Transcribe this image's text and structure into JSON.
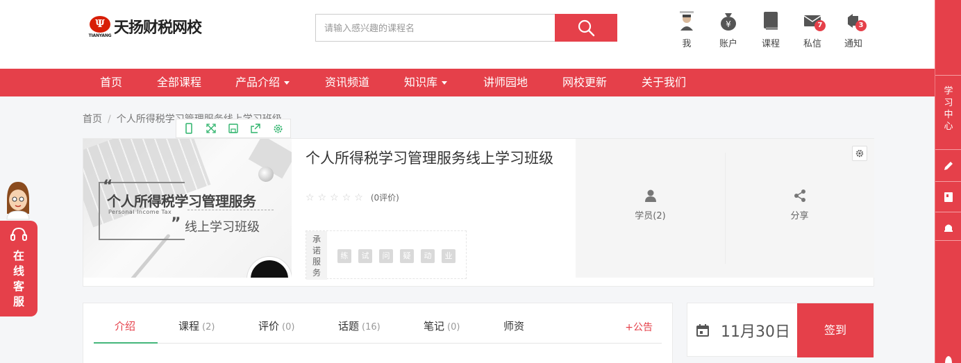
{
  "header": {
    "logo_text": "天扬财税网校",
    "logo_sub": "TIANYANG",
    "search_placeholder": "请输入感兴趣的课程名",
    "icons": [
      {
        "label": "我",
        "icon": "user-avatar-icon"
      },
      {
        "label": "账户",
        "icon": "money-bag-icon"
      },
      {
        "label": "课程",
        "icon": "book-icon"
      },
      {
        "label": "私信",
        "icon": "mail-icon",
        "badge": "7"
      },
      {
        "label": "通知",
        "icon": "bell-icon",
        "badge": "3"
      }
    ]
  },
  "nav": {
    "items": [
      {
        "label": "首页"
      },
      {
        "label": "全部课程"
      },
      {
        "label": "产品介绍",
        "dropdown": true
      },
      {
        "label": "资讯频道"
      },
      {
        "label": "知识库",
        "dropdown": true
      },
      {
        "label": "讲师园地"
      },
      {
        "label": "网校更新"
      },
      {
        "label": "关于我们"
      }
    ]
  },
  "right_sidebar": {
    "learn_center": "学习中心"
  },
  "breadcrumb": {
    "home": "首页",
    "sep": "/",
    "current": "个人所得税学习管理服务线上学习班级"
  },
  "course": {
    "cover_title_1": "个人所得税学习管理服务",
    "cover_title_en": "Personal Income Tax",
    "cover_title_2": "线上学习班级",
    "title": "个人所得税学习管理服务线上学习班级",
    "rating_count": "(0评价)",
    "promise_label": "承诺服务",
    "promise_tags": [
      "练",
      "试",
      "问",
      "疑",
      "动",
      "业"
    ],
    "students_label": "学员(2)",
    "share_label": "分享"
  },
  "tabs": {
    "items": [
      {
        "label": "介绍",
        "count": ""
      },
      {
        "label": "课程",
        "count": "(2)"
      },
      {
        "label": "评价",
        "count": "(0)"
      },
      {
        "label": "话题",
        "count": "(16)"
      },
      {
        "label": "笔记",
        "count": "(0)"
      },
      {
        "label": "师资",
        "count": ""
      }
    ],
    "notice": "+公告"
  },
  "signin": {
    "date": "11月30日",
    "button": "签到"
  },
  "service": {
    "label": "在线客服"
  },
  "colors": {
    "brand_red": "#e5404a",
    "active_tab_underline": "#43b67a"
  }
}
